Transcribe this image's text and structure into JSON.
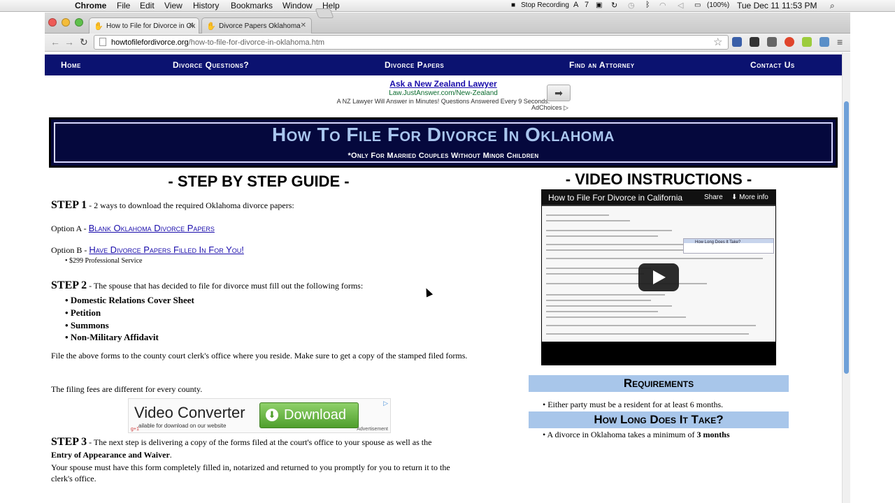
{
  "menubar": {
    "app": "Chrome",
    "items": [
      "File",
      "Edit",
      "View",
      "History",
      "Bookmarks",
      "Window",
      "Help"
    ],
    "stop_recording": "Stop Recording",
    "badge": "7",
    "battery": "(100%)",
    "datetime": "Tue Dec 11  11:53 PM"
  },
  "tabs": [
    {
      "title": "How to File for Divorce in Ok"
    },
    {
      "title": "Divorce Papers Oklahoma"
    }
  ],
  "omnibox": {
    "host": "howtofilefordivorce.org",
    "path": "/how-to-file-for-divorce-in-oklahoma.htm"
  },
  "site_nav": [
    "Home",
    "Divorce Questions?",
    "Divorce Papers",
    "Find an Attorney",
    "Contact Us"
  ],
  "ad_top": {
    "title": "Ask a New Zealand Lawyer",
    "url": "Law.JustAnswer.com/New-Zealand",
    "text": "A NZ Lawyer Will Answer in Minutes! Questions Answered Every 9 Seconds.",
    "arrow": "➡",
    "adchoices": "AdChoices ▷"
  },
  "header": {
    "title": "How To File For Divorce In Oklahoma",
    "subtitle": "*Only For Married Couples Without Minor Children"
  },
  "guide_heading": "- STEP BY STEP GUIDE -",
  "video_heading": "- VIDEO INSTRUCTIONS -",
  "step1": {
    "label": "STEP 1",
    "text": " - 2 ways to download the required Oklahoma divorce papers:",
    "option_a_prefix": "Option A - ",
    "option_a_link": "Blank Oklahoma Divorce Papers",
    "option_b_prefix": "Option B - ",
    "option_b_link": "Have Divorce Papers Filled In For You!",
    "option_b_note": "$299 Professional Service"
  },
  "step2": {
    "label": "STEP 2",
    "text": " - The spouse that has decided to file for divorce must fill out the following forms:",
    "forms": [
      "Domestic Relations Cover Sheet",
      "Petition",
      "Summons",
      "Non-Military Affidavit"
    ],
    "para1": "File the above forms to the county court clerk's office where you reside. Make sure to get a copy of the stamped filed forms.",
    "para2": "The filing fees are different for every county."
  },
  "ad_mid": {
    "title": "Video Converter",
    "button": "Download",
    "note": "ailable for download on our website",
    "advert": "Advertisement",
    "gplus": "g+1"
  },
  "step3": {
    "label": "STEP 3",
    "text": " - The next step is delivering a copy of the forms filed at the court's office to your spouse as well as the",
    "bold": "Entry of Appearance and Waiver",
    "after": ".",
    "para": "Your spouse must have this form completely filled in, notarized and returned to you promptly for you to return it to the clerk's office."
  },
  "video": {
    "title": "How to File For Divorce in California",
    "share": "Share",
    "more": "More info",
    "callout": "How Long Does It Take?"
  },
  "requirements": {
    "heading": "Requirements",
    "item": "Either party must be a resident for at least 6 months."
  },
  "how_long": {
    "heading": "How Long Does It Take?",
    "item_prefix": "A divorce in Oklahoma takes a minimum of ",
    "item_bold": "3 months"
  },
  "colors": {
    "nav_bg": "#0b1270",
    "title_bg": "#05083d",
    "title_text": "#a9c6ee",
    "section_bar": "#a8c6ea",
    "link": "#1a0dab"
  }
}
